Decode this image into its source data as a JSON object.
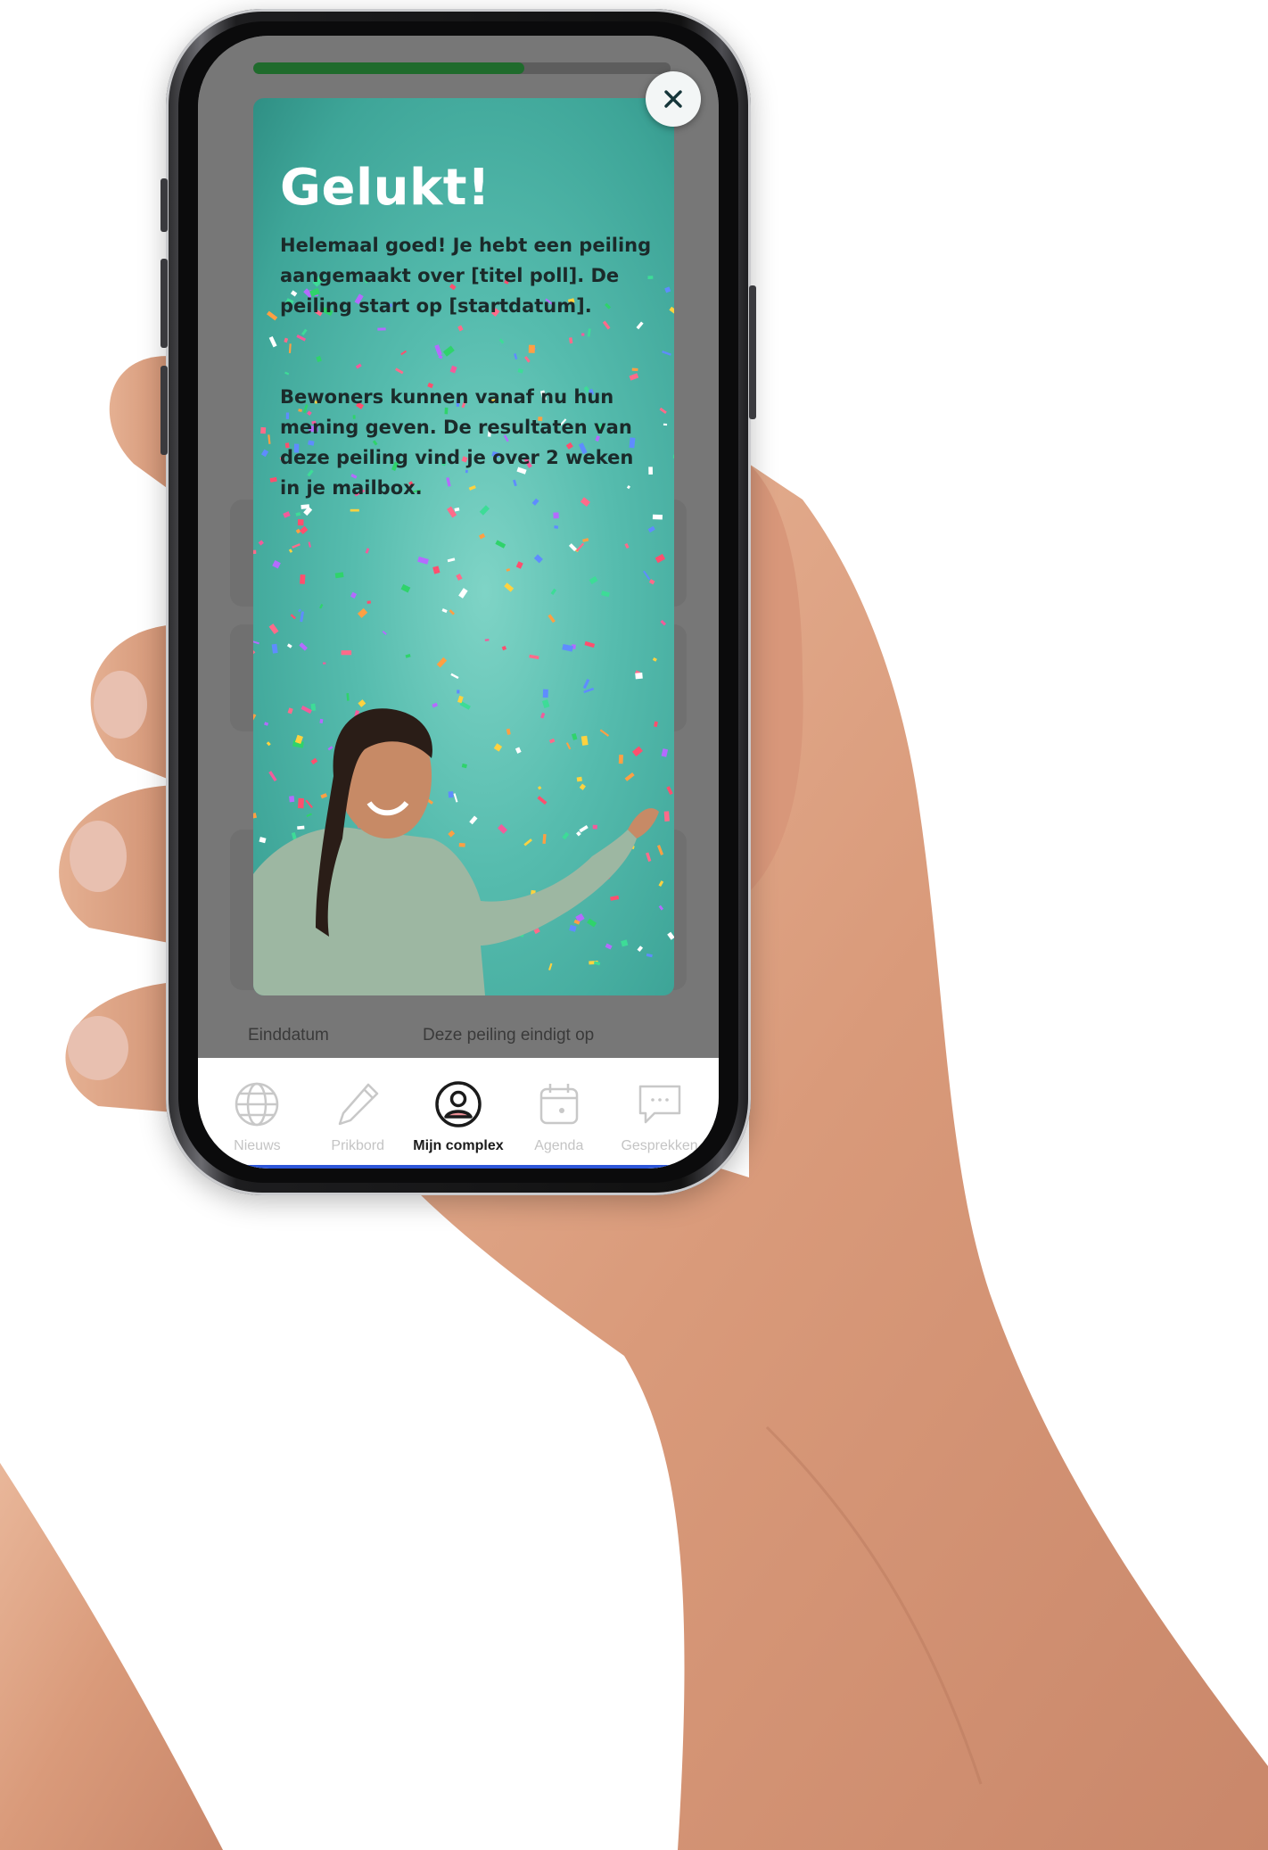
{
  "progress": {
    "fraction": 0.65,
    "color": "#1f6b2c"
  },
  "modal": {
    "title": "Gelukt!",
    "paragraph_1": "Helemaal goed! Je hebt een peiling aangemaakt over [titel poll]. De peiling start op [startdatum].",
    "paragraph_2": "Bewoners kunnen vanaf nu hun mening geven. De resultaten van deze peiling vind je over 2 weken in je mailbox.",
    "background_color": "#56bcae",
    "close_icon": "close-icon"
  },
  "background_row": {
    "label": "Einddatum",
    "value": "Deze peiling eindigt op"
  },
  "tabbar": {
    "tabs": [
      {
        "label": "Nieuws",
        "icon": "globe-icon",
        "active": false
      },
      {
        "label": "Prikbord",
        "icon": "pencil-icon",
        "active": false
      },
      {
        "label": "Mijn complex",
        "icon": "user-circle-icon",
        "active": true
      },
      {
        "label": "Agenda",
        "icon": "calendar-icon",
        "active": false
      },
      {
        "label": "Gesprekken",
        "icon": "chat-icon",
        "active": false
      }
    ]
  }
}
